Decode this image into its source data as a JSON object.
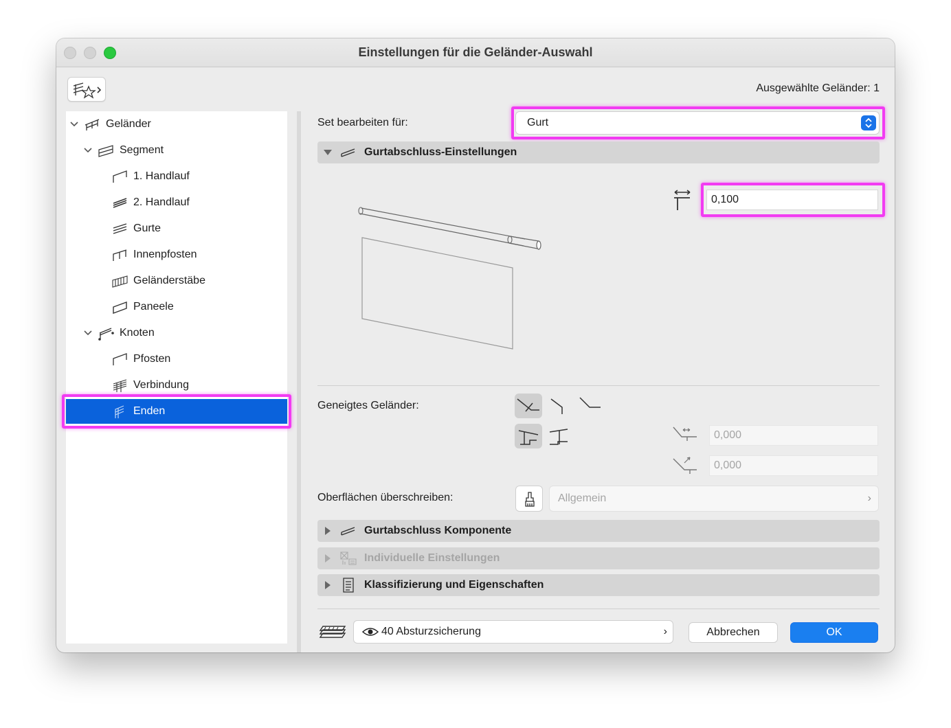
{
  "window": {
    "title": "Einstellungen für die Geländer-Auswahl",
    "selected_count": "Ausgewählte Geländer: 1"
  },
  "tree": {
    "items": [
      {
        "label": "Geländer",
        "icon": "railing-icon"
      },
      {
        "label": "Segment",
        "icon": "segment-icon"
      },
      {
        "label": "1. Handlauf",
        "icon": "handrail-icon"
      },
      {
        "label": "2. Handlauf",
        "icon": "handrail-2-icon"
      },
      {
        "label": "Gurte",
        "icon": "rails-icon"
      },
      {
        "label": "Innenpfosten",
        "icon": "inner-post-icon"
      },
      {
        "label": "Geländerstäbe",
        "icon": "balusters-icon"
      },
      {
        "label": "Paneele",
        "icon": "panel-icon"
      },
      {
        "label": "Knoten",
        "icon": "node-icon"
      },
      {
        "label": "Pfosten",
        "icon": "post-icon"
      },
      {
        "label": "Verbindung",
        "icon": "connection-icon"
      },
      {
        "label": "Enden",
        "icon": "ends-icon"
      }
    ],
    "selected": "Enden"
  },
  "main": {
    "edit_set_label": "Set bearbeiten für:",
    "edit_set_value": "Gurt",
    "section_settings": "Gurtabschluss-Einstellungen",
    "offset_value": "0,100",
    "inclined_label": "Geneigtes Geländer:",
    "inclined_value_1": "0,000",
    "inclined_value_2": "0,000",
    "surface_label": "Oberflächen überschreiben:",
    "surface_value": "Allgemein",
    "section_component": "Gurtabschluss Komponente",
    "section_individual": "Individuelle Einstellungen",
    "section_classification": "Klassifizierung und Eigenschaften"
  },
  "footer": {
    "layer_label": "40 Absturzsicherung",
    "cancel_label": "Abbrechen",
    "ok_label": "OK"
  },
  "colors": {
    "selection": "#0a62dc",
    "highlight": "#f23bf2",
    "ok_button": "#1a7ff0"
  }
}
